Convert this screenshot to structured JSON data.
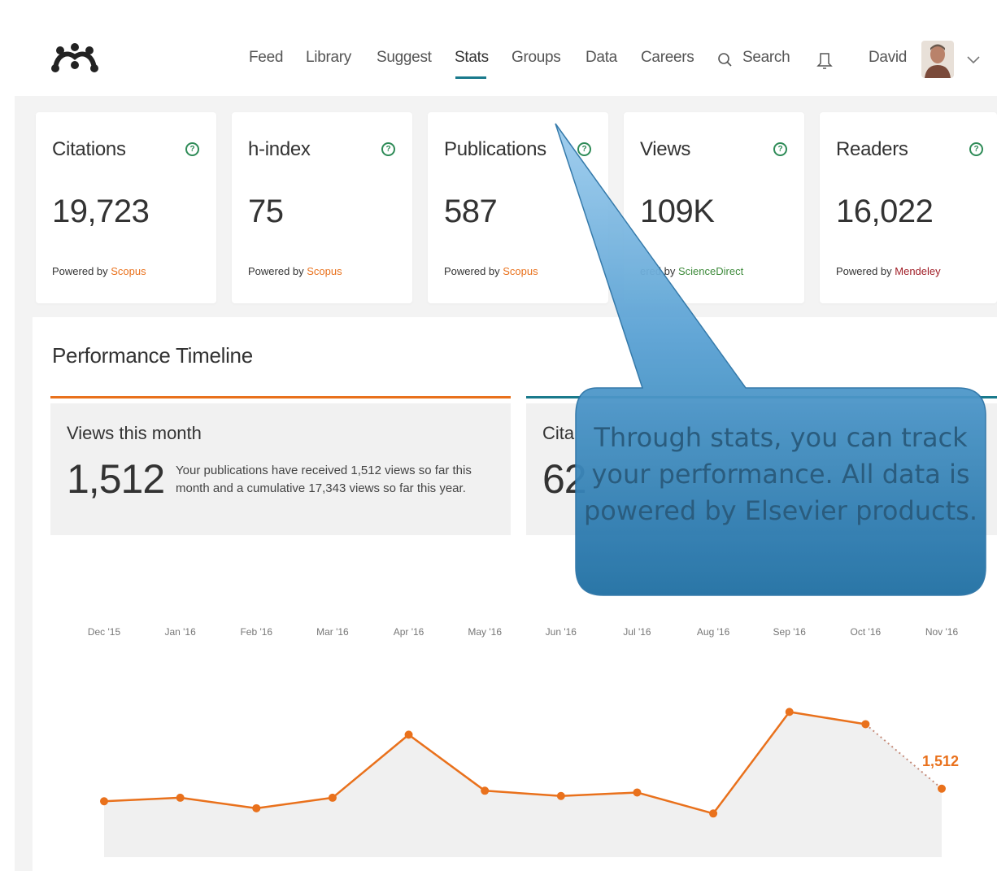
{
  "header": {
    "nav": [
      "Feed",
      "Library",
      "Suggest",
      "Stats",
      "Groups",
      "Data",
      "Careers"
    ],
    "active_nav": "Stats",
    "search_label": "Search",
    "user_name": "David"
  },
  "metrics": [
    {
      "title": "Citations",
      "value": "19,723",
      "powered_prefix": "Powered by ",
      "source": "Scopus"
    },
    {
      "title": "h-index",
      "value": "75",
      "powered_prefix": "Powered by ",
      "source": "Scopus"
    },
    {
      "title": "Publications",
      "value": "587",
      "powered_prefix": "Powered by ",
      "source": "Scopus"
    },
    {
      "title": "Views",
      "value": "109K",
      "powered_prefix": "ered by ",
      "source": "ScienceDirect"
    },
    {
      "title": "Readers",
      "value": "16,022",
      "powered_prefix": "Powered by ",
      "source": "Mendeley"
    }
  ],
  "timeline": {
    "title": "Performance Timeline",
    "views_tab": {
      "label": "Views this month",
      "value": "1,512",
      "description": "Your publications have received 1,512 views so far this month and a cumulative 17,343 views so far this year."
    },
    "citations_tab": {
      "label": "Cita",
      "value": "62"
    }
  },
  "callout_text": "Through stats, you can track your performance. All data is powered by Elsevier products.",
  "colors": {
    "views_line": "#e9711c",
    "tab_active": "#e9711c",
    "tab_secondary": "#1a7a8c",
    "scopus": "#e9711c",
    "sciencedirect": "#3d8a3a",
    "mendeley": "#a01d26",
    "callout_fill": "#1f6fa3"
  },
  "chart_data": {
    "type": "line",
    "categories": [
      "Dec '15",
      "Jan '16",
      "Feb '16",
      "Mar '16",
      "Apr '16",
      "May '16",
      "Jun '16",
      "Jul '16",
      "Aug '16",
      "Sep '16",
      "Oct '16",
      "Nov '16"
    ],
    "series": [
      {
        "values": [
          1440,
          1460,
          1400,
          1460,
          1820,
          1500,
          1470,
          1490,
          1370,
          1950,
          1880,
          1512
        ]
      }
    ],
    "end_label": "1,512",
    "last_segment_dashed": true
  }
}
